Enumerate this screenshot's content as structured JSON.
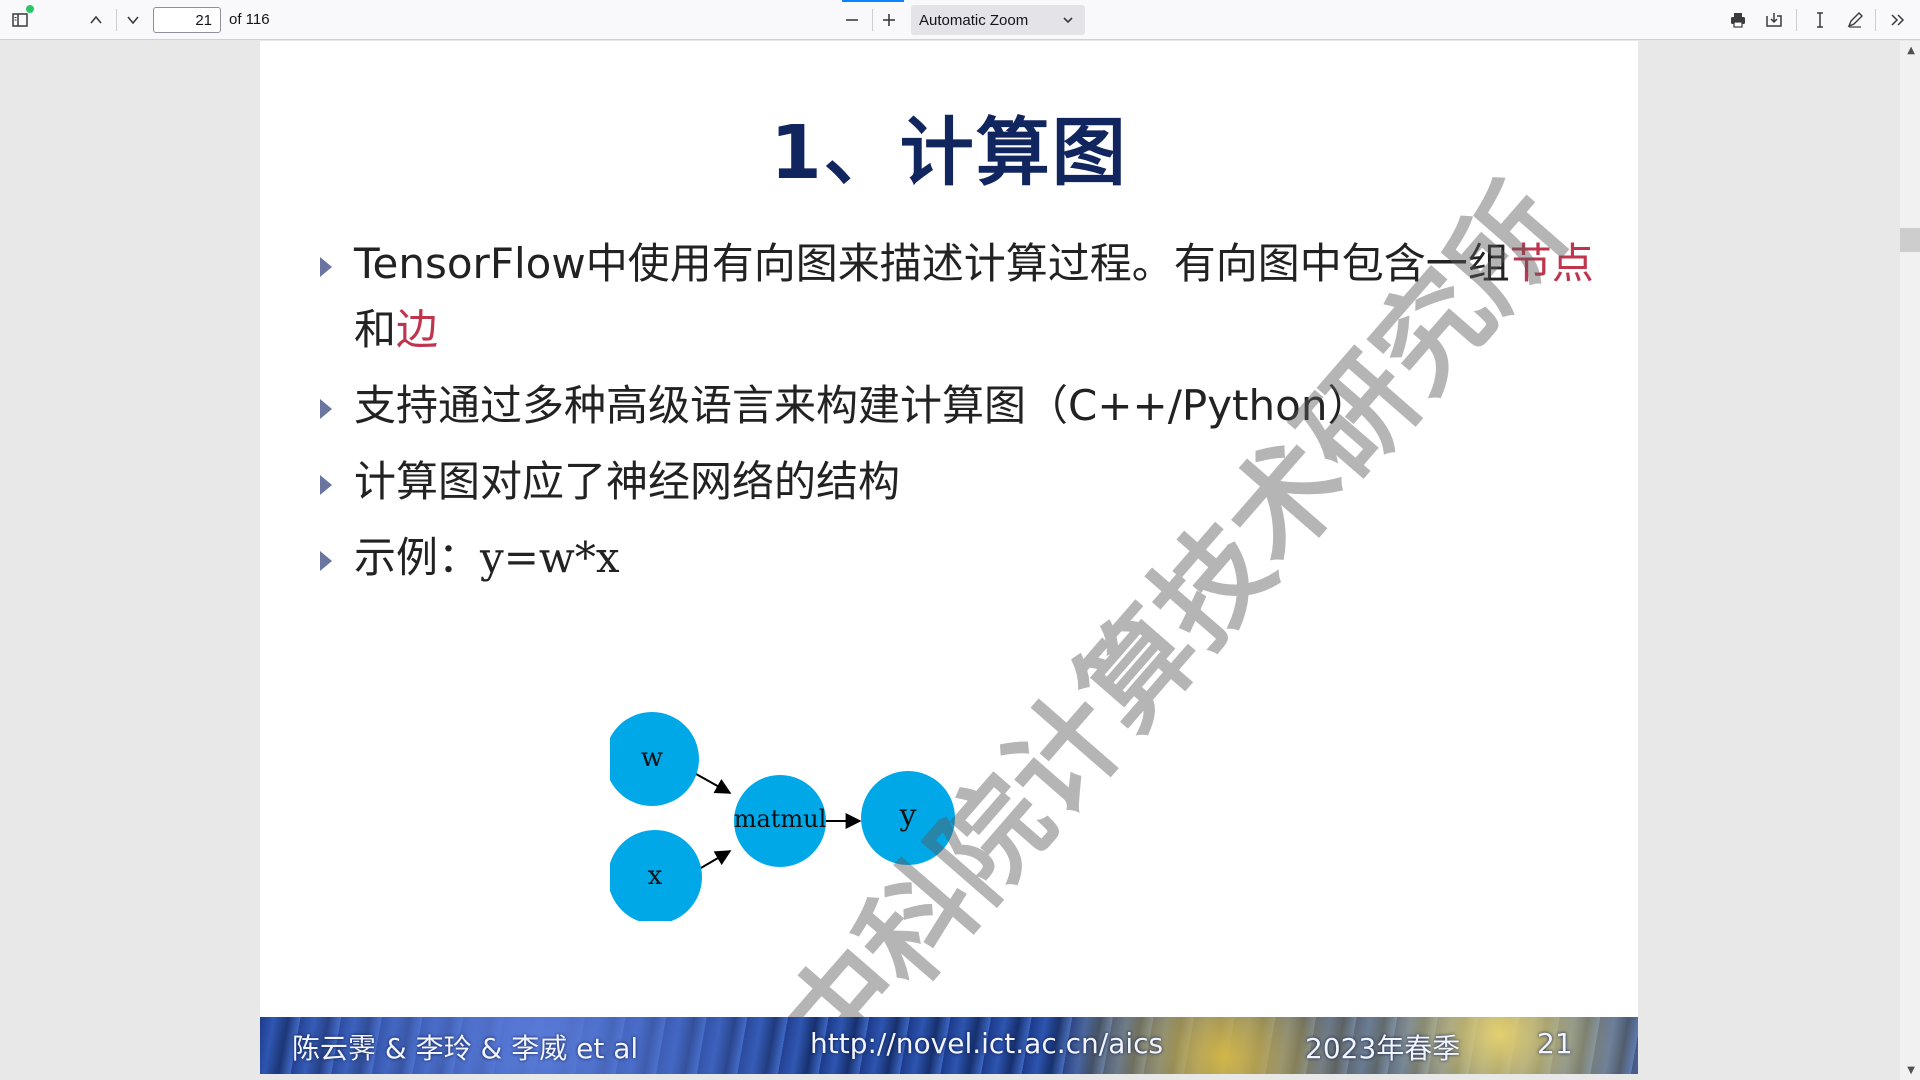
{
  "toolbar": {
    "page_number": "21",
    "page_of": "of 116",
    "zoom_label": "Automatic Zoom"
  },
  "slide": {
    "title": "1、计算图",
    "bullets": {
      "b1_text": "TensorFlow中使用有向图来描述计算过程。有向图中包含一组",
      "b1_red1": "节点",
      "b1_mid": "和",
      "b1_red2": "边",
      "b2": "支持通过多种高级语言来构建计算图（C++/Python）",
      "b3": "计算图对应了神经网络的结构",
      "b4_prefix": "示例：",
      "b4_math": "y=w*x"
    },
    "graph": {
      "nodes": [
        "w",
        "x",
        "matmul",
        "y"
      ],
      "node_color": "#00a8e8"
    },
    "watermark": "中科院计算技术研究所",
    "footer": {
      "authors": "陈云霁 & 李玲 & 李威 et al",
      "url": "http://novel.ict.ac.cn/aics",
      "term": "2023年春季",
      "page": "21"
    }
  },
  "colors": {
    "title": "#11255e",
    "highlight": "#c0354e",
    "bullet_marker": "#6b76a0"
  }
}
